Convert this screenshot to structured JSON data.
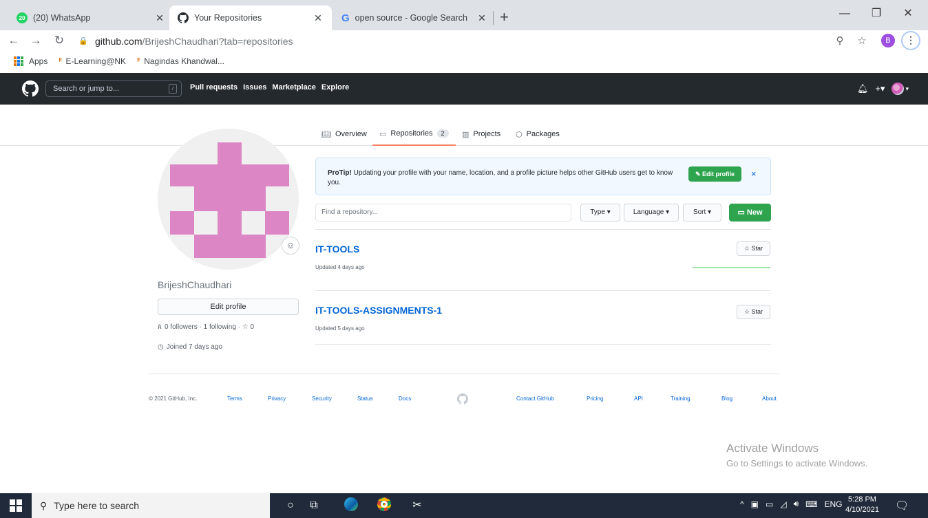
{
  "browser": {
    "tabs": [
      {
        "title": "(20) WhatsApp",
        "badge": "20"
      },
      {
        "title": "Your Repositories"
      },
      {
        "title": "open source - Google Search"
      }
    ],
    "url_host": "github.com",
    "url_path": "/BrijeshChaudhari?tab=repositories",
    "profile_initial": "B",
    "bookmarks": [
      "Apps",
      "E-Learning@NK",
      "Nagindas Khandwal..."
    ]
  },
  "github": {
    "search_placeholder": "Search or jump to...",
    "search_key": "/",
    "nav": [
      "Pull requests",
      "Issues",
      "Marketplace",
      "Explore"
    ],
    "tabs": [
      {
        "label": "Overview"
      },
      {
        "label": "Repositories",
        "count": "2"
      },
      {
        "label": "Projects"
      },
      {
        "label": "Packages"
      }
    ]
  },
  "profile": {
    "username": "BrijeshChaudhari",
    "edit_label": "Edit profile",
    "follow_text": "0 followers · 1 following · ☆ 0",
    "joined": "Joined 7 days ago"
  },
  "protip": {
    "lead": "ProTip!",
    "text": " Updating your profile with your name, location, and a profile picture helps other GitHub users get to know you.",
    "button": "Edit profile",
    "close": "×"
  },
  "filters": {
    "find_placeholder": "Find a repository...",
    "type": "Type",
    "language": "Language",
    "sort": "Sort",
    "new": "New"
  },
  "repos": [
    {
      "name": "IT-TOOLS",
      "updated": "Updated 4 days ago",
      "star": "Star"
    },
    {
      "name": "IT-TOOLS-ASSIGNMENTS-1",
      "updated": "Updated 5 days ago",
      "star": "Star"
    }
  ],
  "footer": {
    "copyright": "© 2021 GitHub, Inc.",
    "links_left": [
      "Terms",
      "Privacy",
      "Security",
      "Status",
      "Docs"
    ],
    "links_right": [
      "Contact GitHub",
      "Pricing",
      "API",
      "Training",
      "Blog",
      "About"
    ]
  },
  "watermark": {
    "line1": "Activate Windows",
    "line2": "Go to Settings to activate Windows."
  },
  "taskbar": {
    "search_placeholder": "Type here to search",
    "lang": "ENG",
    "time": "5:28 PM",
    "date": "4/10/2021"
  },
  "colors": {
    "gh_header": "#24292e",
    "link": "#0366d6",
    "green_button": "#2ea44f",
    "active_tab_underline": "#f9826c",
    "avatar_pink": "#dd86c5"
  }
}
